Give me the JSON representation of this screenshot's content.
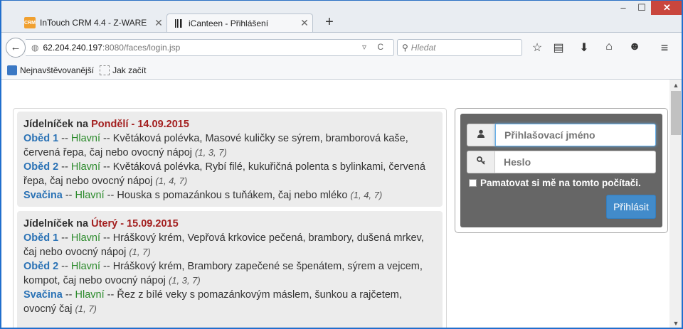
{
  "browser": {
    "tabs": [
      {
        "title": "InTouch CRM 4.4 - Z-WARE",
        "favicon": "crm-icon",
        "favicon_text": "CRM",
        "active": false
      },
      {
        "title": "iCanteen - Přihlášení",
        "favicon": "fork-knife-icon",
        "favicon_text": "ᛘ",
        "active": true
      }
    ],
    "url": {
      "host": "62.204.240.197",
      "path": ":8080/faces/login.jsp"
    },
    "search_placeholder": "Hledat",
    "bookmarks": [
      {
        "label": "Nejnavštěvovanější"
      },
      {
        "label": "Jak začít"
      }
    ]
  },
  "menu": {
    "days": [
      {
        "prefix": "Jídelníček na ",
        "day": "Pondělí - 14.09.2015",
        "items": [
          {
            "meal": "Oběd 1",
            "kind": "Hlavní",
            "text": "Květáková polévka, Masové kuličky se sýrem, bramborová kaše, červená řepa, čaj nebo ovocný nápoj",
            "allergens": "(1, 3, 7)"
          },
          {
            "meal": "Oběd 2",
            "kind": "Hlavní",
            "text": "Květáková polévka, Rybí filé, kukuřičná polenta s bylinkami, červená řepa, čaj nebo ovocný nápoj",
            "allergens": "(1, 4, 7)"
          },
          {
            "meal": "Svačina",
            "kind": "Hlavní",
            "text": "Houska s pomazánkou s tuňákem, čaj nebo mléko",
            "allergens": "(1, 4, 7)"
          }
        ]
      },
      {
        "prefix": "Jídelníček na ",
        "day": "Úterý - 15.09.2015",
        "items": [
          {
            "meal": "Oběd 1",
            "kind": "Hlavní",
            "text": "Hráškový krém, Vepřová krkovice pečená, brambory, dušená mrkev, čaj nebo ovocný nápoj",
            "allergens": "(1, 7)"
          },
          {
            "meal": "Oběd 2",
            "kind": "Hlavní",
            "text": "Hráškový krém, Brambory zapečené se špenátem, sýrem a vejcem, kompot, čaj nebo ovocný nápoj",
            "allergens": "(1, 3, 7)"
          },
          {
            "meal": "Svačina",
            "kind": "Hlavní",
            "text": "Řez z bílé veky s pomazánkovým máslem, šunkou a rajčetem, ovocný čaj",
            "allergens": "(1, 7)"
          }
        ]
      }
    ]
  },
  "login": {
    "username_placeholder": "Přihlašovací jméno",
    "password_placeholder": "Heslo",
    "remember_label": "Pamatovat si mě na tomto počítači.",
    "submit_label": "Přihlásit"
  }
}
